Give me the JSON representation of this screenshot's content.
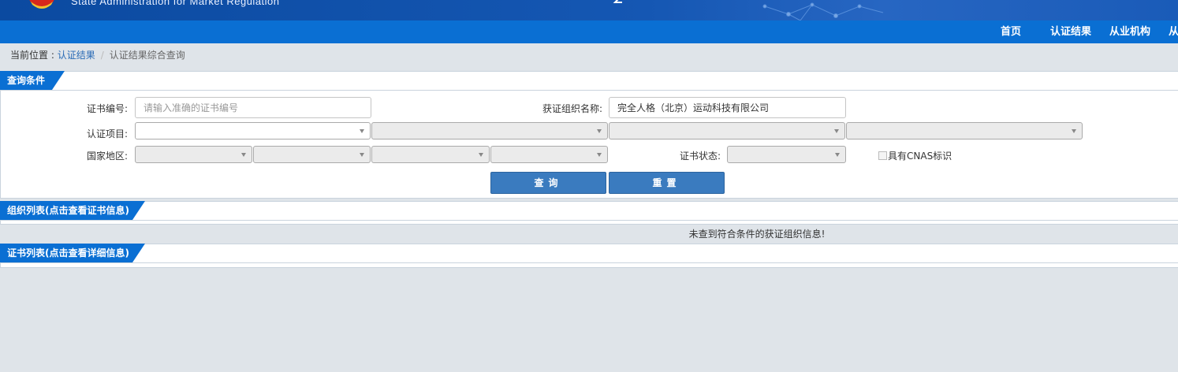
{
  "header": {
    "agency_en": "State Administration for Market Regulation",
    "accent_color": "#0a6fd3"
  },
  "nav": {
    "items": [
      {
        "label": "首页"
      },
      {
        "label": "认证结果"
      },
      {
        "label": "从业机构"
      },
      {
        "label": "从"
      }
    ]
  },
  "breadcrumb": {
    "prefix": "当前位置 : ",
    "link": "认证结果",
    "separator": "/",
    "current": "认证结果综合查询"
  },
  "query_panel": {
    "title": "查询条件",
    "cert_no_label": "证书编号:",
    "cert_no_placeholder": "请输入准确的证书编号",
    "org_name_label": "获证组织名称:",
    "org_name_value": "完全人格（北京）运动科技有限公司",
    "project_label": "认证项目:",
    "region_label": "国家地区:",
    "status_label": "证书状态:",
    "cnas_label": "具有CNAS标识",
    "search_button": "查询",
    "reset_button": "重置"
  },
  "org_list_panel": {
    "title": "组织列表(点击查看证书信息)",
    "empty_message": "未查到符合条件的获证组织信息!"
  },
  "cert_list_panel": {
    "title": "证书列表(点击查看详细信息)"
  }
}
